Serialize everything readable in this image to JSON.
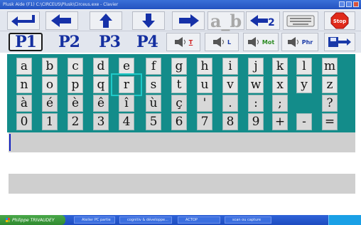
{
  "window": {
    "title": "Plusk    Aide (F1)    C:\\CIRCEUS\\Plusk\\Circeus.exe - Clavier",
    "controls": [
      "minimize",
      "maximize",
      "close"
    ]
  },
  "toolbar_row1": {
    "keys": [
      {
        "name": "enter-key",
        "icon": "enter-arrow-icon"
      },
      {
        "name": "arrow-left-key",
        "icon": "arrow-left-icon"
      },
      {
        "name": "arrow-up-key",
        "icon": "arrow-up-icon"
      },
      {
        "name": "arrow-down-key",
        "icon": "arrow-down-icon"
      },
      {
        "name": "arrow-right-key",
        "icon": "arrow-right-icon"
      },
      {
        "name": "space-key",
        "icon": "space-icon",
        "label": "a_b"
      },
      {
        "name": "backspace-key",
        "icon": "backspace-icon"
      },
      {
        "name": "keyboard-key",
        "icon": "keyboard-icon"
      },
      {
        "name": "stop-key",
        "icon": "stop-sign-icon",
        "label": "Stop"
      }
    ]
  },
  "toolbar_row2": {
    "pages": [
      "P1",
      "P2",
      "P3",
      "P4"
    ],
    "active_page": "P1",
    "speech": [
      {
        "name": "speak-text",
        "label": "T",
        "color": "#d02020"
      },
      {
        "name": "speak-letter",
        "label": "L",
        "color": "#1a3aa8"
      },
      {
        "name": "speak-word",
        "label": "Mot",
        "color": "#2a8a20"
      },
      {
        "name": "speak-sentence",
        "label": "Phr",
        "color": "#1a3aa8"
      }
    ],
    "save_icon": "save-icon"
  },
  "keyboard": {
    "background": "#138c8a",
    "rows": [
      [
        "a",
        "b",
        "c",
        "d",
        "e",
        "f",
        "g",
        "h",
        "i",
        "j",
        "k",
        "l",
        "m"
      ],
      [
        "n",
        "o",
        "p",
        "q",
        "r",
        "s",
        "t",
        "u",
        "v",
        "w",
        "x",
        "y",
        "z"
      ],
      [
        "à",
        "é",
        "è",
        "ê",
        "î",
        "ù",
        "ç",
        "'",
        ".",
        ":",
        ";",
        "?"
      ],
      [
        "0",
        "1",
        "2",
        "3",
        "4",
        "5",
        "6",
        "7",
        "8",
        "9",
        "+",
        "-",
        "="
      ]
    ],
    "focused_key": "r"
  },
  "text_area": {
    "lines": [
      "",
      "",
      "",
      ""
    ]
  },
  "taskbar": {
    "start_label": "Philippe TRIVAUDEY",
    "tasks": [
      "Atelier PC partie",
      "cognitiv & développe...",
      "ACTOP",
      "scan ou capture"
    ],
    "accent": "#2f63d8"
  }
}
